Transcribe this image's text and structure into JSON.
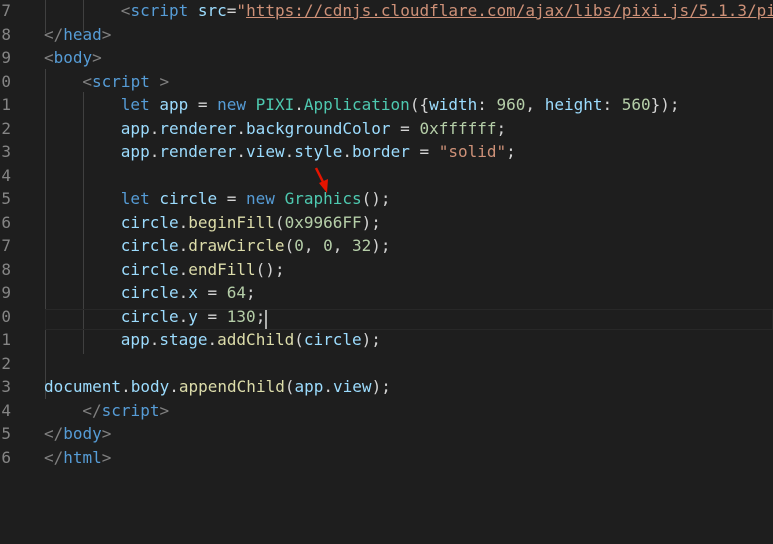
{
  "editor": {
    "line_numbers": [
      "7",
      "8",
      "9",
      "0",
      "1",
      "2",
      "3",
      "4",
      "5",
      "6",
      "7",
      "8",
      "9",
      "0",
      "1",
      "2",
      "3",
      "4",
      "5",
      "6"
    ],
    "lines": [
      [
        {
          "t": "<",
          "c": "punc"
        },
        {
          "t": "script ",
          "c": "tag"
        },
        {
          "t": "src",
          "c": "attr"
        },
        {
          "t": "=",
          "c": "txt"
        },
        {
          "t": "\"",
          "c": "str"
        },
        {
          "t": "https://cdnjs.cloudflare.com/ajax/libs/pixi.js/5.1.3/pi",
          "c": "url"
        }
      ],
      [
        {
          "t": "</",
          "c": "punc"
        },
        {
          "t": "head",
          "c": "tag"
        },
        {
          "t": ">",
          "c": "punc"
        }
      ],
      [
        {
          "t": "<",
          "c": "punc"
        },
        {
          "t": "body",
          "c": "tag"
        },
        {
          "t": ">",
          "c": "punc"
        }
      ],
      [
        {
          "t": "<",
          "c": "punc"
        },
        {
          "t": "script ",
          "c": "tag"
        },
        {
          "t": ">",
          "c": "punc"
        }
      ],
      [
        {
          "t": "let ",
          "c": "kw"
        },
        {
          "t": "app",
          "c": "var"
        },
        {
          "t": " = ",
          "c": "txt"
        },
        {
          "t": "new ",
          "c": "kw"
        },
        {
          "t": "PIXI",
          "c": "cls"
        },
        {
          "t": ".",
          "c": "txt"
        },
        {
          "t": "Application",
          "c": "cls"
        },
        {
          "t": "({",
          "c": "txt"
        },
        {
          "t": "width",
          "c": "var"
        },
        {
          "t": ": ",
          "c": "txt"
        },
        {
          "t": "960",
          "c": "num"
        },
        {
          "t": ", ",
          "c": "txt"
        },
        {
          "t": "height",
          "c": "var"
        },
        {
          "t": ": ",
          "c": "txt"
        },
        {
          "t": "560",
          "c": "num"
        },
        {
          "t": "});",
          "c": "txt"
        }
      ],
      [
        {
          "t": "app",
          "c": "var"
        },
        {
          "t": ".",
          "c": "txt"
        },
        {
          "t": "renderer",
          "c": "var"
        },
        {
          "t": ".",
          "c": "txt"
        },
        {
          "t": "backgroundColor",
          "c": "var"
        },
        {
          "t": " = ",
          "c": "txt"
        },
        {
          "t": "0xffffff",
          "c": "num"
        },
        {
          "t": ";",
          "c": "txt"
        }
      ],
      [
        {
          "t": "app",
          "c": "var"
        },
        {
          "t": ".",
          "c": "txt"
        },
        {
          "t": "renderer",
          "c": "var"
        },
        {
          "t": ".",
          "c": "txt"
        },
        {
          "t": "view",
          "c": "var"
        },
        {
          "t": ".",
          "c": "txt"
        },
        {
          "t": "style",
          "c": "var"
        },
        {
          "t": ".",
          "c": "txt"
        },
        {
          "t": "border",
          "c": "var"
        },
        {
          "t": " = ",
          "c": "txt"
        },
        {
          "t": "\"solid\"",
          "c": "str"
        },
        {
          "t": ";",
          "c": "txt"
        }
      ],
      [],
      [
        {
          "t": "let ",
          "c": "kw"
        },
        {
          "t": "circle",
          "c": "var"
        },
        {
          "t": " = ",
          "c": "txt"
        },
        {
          "t": "new ",
          "c": "kw"
        },
        {
          "t": "Graphics",
          "c": "cls"
        },
        {
          "t": "();",
          "c": "txt"
        }
      ],
      [
        {
          "t": "circle",
          "c": "var"
        },
        {
          "t": ".",
          "c": "txt"
        },
        {
          "t": "beginFill",
          "c": "fn"
        },
        {
          "t": "(",
          "c": "txt"
        },
        {
          "t": "0x9966FF",
          "c": "num"
        },
        {
          "t": ");",
          "c": "txt"
        }
      ],
      [
        {
          "t": "circle",
          "c": "var"
        },
        {
          "t": ".",
          "c": "txt"
        },
        {
          "t": "drawCircle",
          "c": "fn"
        },
        {
          "t": "(",
          "c": "txt"
        },
        {
          "t": "0",
          "c": "num"
        },
        {
          "t": ", ",
          "c": "txt"
        },
        {
          "t": "0",
          "c": "num"
        },
        {
          "t": ", ",
          "c": "txt"
        },
        {
          "t": "32",
          "c": "num"
        },
        {
          "t": ");",
          "c": "txt"
        }
      ],
      [
        {
          "t": "circle",
          "c": "var"
        },
        {
          "t": ".",
          "c": "txt"
        },
        {
          "t": "endFill",
          "c": "fn"
        },
        {
          "t": "();",
          "c": "txt"
        }
      ],
      [
        {
          "t": "circle",
          "c": "var"
        },
        {
          "t": ".",
          "c": "txt"
        },
        {
          "t": "x",
          "c": "var"
        },
        {
          "t": " = ",
          "c": "txt"
        },
        {
          "t": "64",
          "c": "num"
        },
        {
          "t": ";",
          "c": "txt"
        }
      ],
      [
        {
          "t": "circle",
          "c": "var"
        },
        {
          "t": ".",
          "c": "txt"
        },
        {
          "t": "y",
          "c": "var"
        },
        {
          "t": " = ",
          "c": "txt"
        },
        {
          "t": "130",
          "c": "num"
        },
        {
          "t": ";",
          "c": "txt"
        }
      ],
      [
        {
          "t": "app",
          "c": "var"
        },
        {
          "t": ".",
          "c": "txt"
        },
        {
          "t": "stage",
          "c": "var"
        },
        {
          "t": ".",
          "c": "txt"
        },
        {
          "t": "addChild",
          "c": "fn"
        },
        {
          "t": "(",
          "c": "txt"
        },
        {
          "t": "circle",
          "c": "var"
        },
        {
          "t": ");",
          "c": "txt"
        }
      ],
      [],
      [
        {
          "t": "document",
          "c": "var"
        },
        {
          "t": ".",
          "c": "txt"
        },
        {
          "t": "body",
          "c": "var"
        },
        {
          "t": ".",
          "c": "txt"
        },
        {
          "t": "appendChild",
          "c": "fn"
        },
        {
          "t": "(",
          "c": "txt"
        },
        {
          "t": "app",
          "c": "var"
        },
        {
          "t": ".",
          "c": "txt"
        },
        {
          "t": "view",
          "c": "var"
        },
        {
          "t": ");",
          "c": "txt"
        }
      ],
      [
        {
          "t": "</",
          "c": "punc"
        },
        {
          "t": "script",
          "c": "tag"
        },
        {
          "t": ">",
          "c": "punc"
        }
      ],
      [
        {
          "t": "</",
          "c": "punc"
        },
        {
          "t": "body",
          "c": "tag"
        },
        {
          "t": ">",
          "c": "punc"
        }
      ],
      [
        {
          "t": "</",
          "c": "punc"
        },
        {
          "t": "html",
          "c": "tag"
        },
        {
          "t": ">",
          "c": "punc"
        }
      ]
    ],
    "annotation": {
      "icon": "red-arrow-icon",
      "color": "#e51400"
    }
  }
}
